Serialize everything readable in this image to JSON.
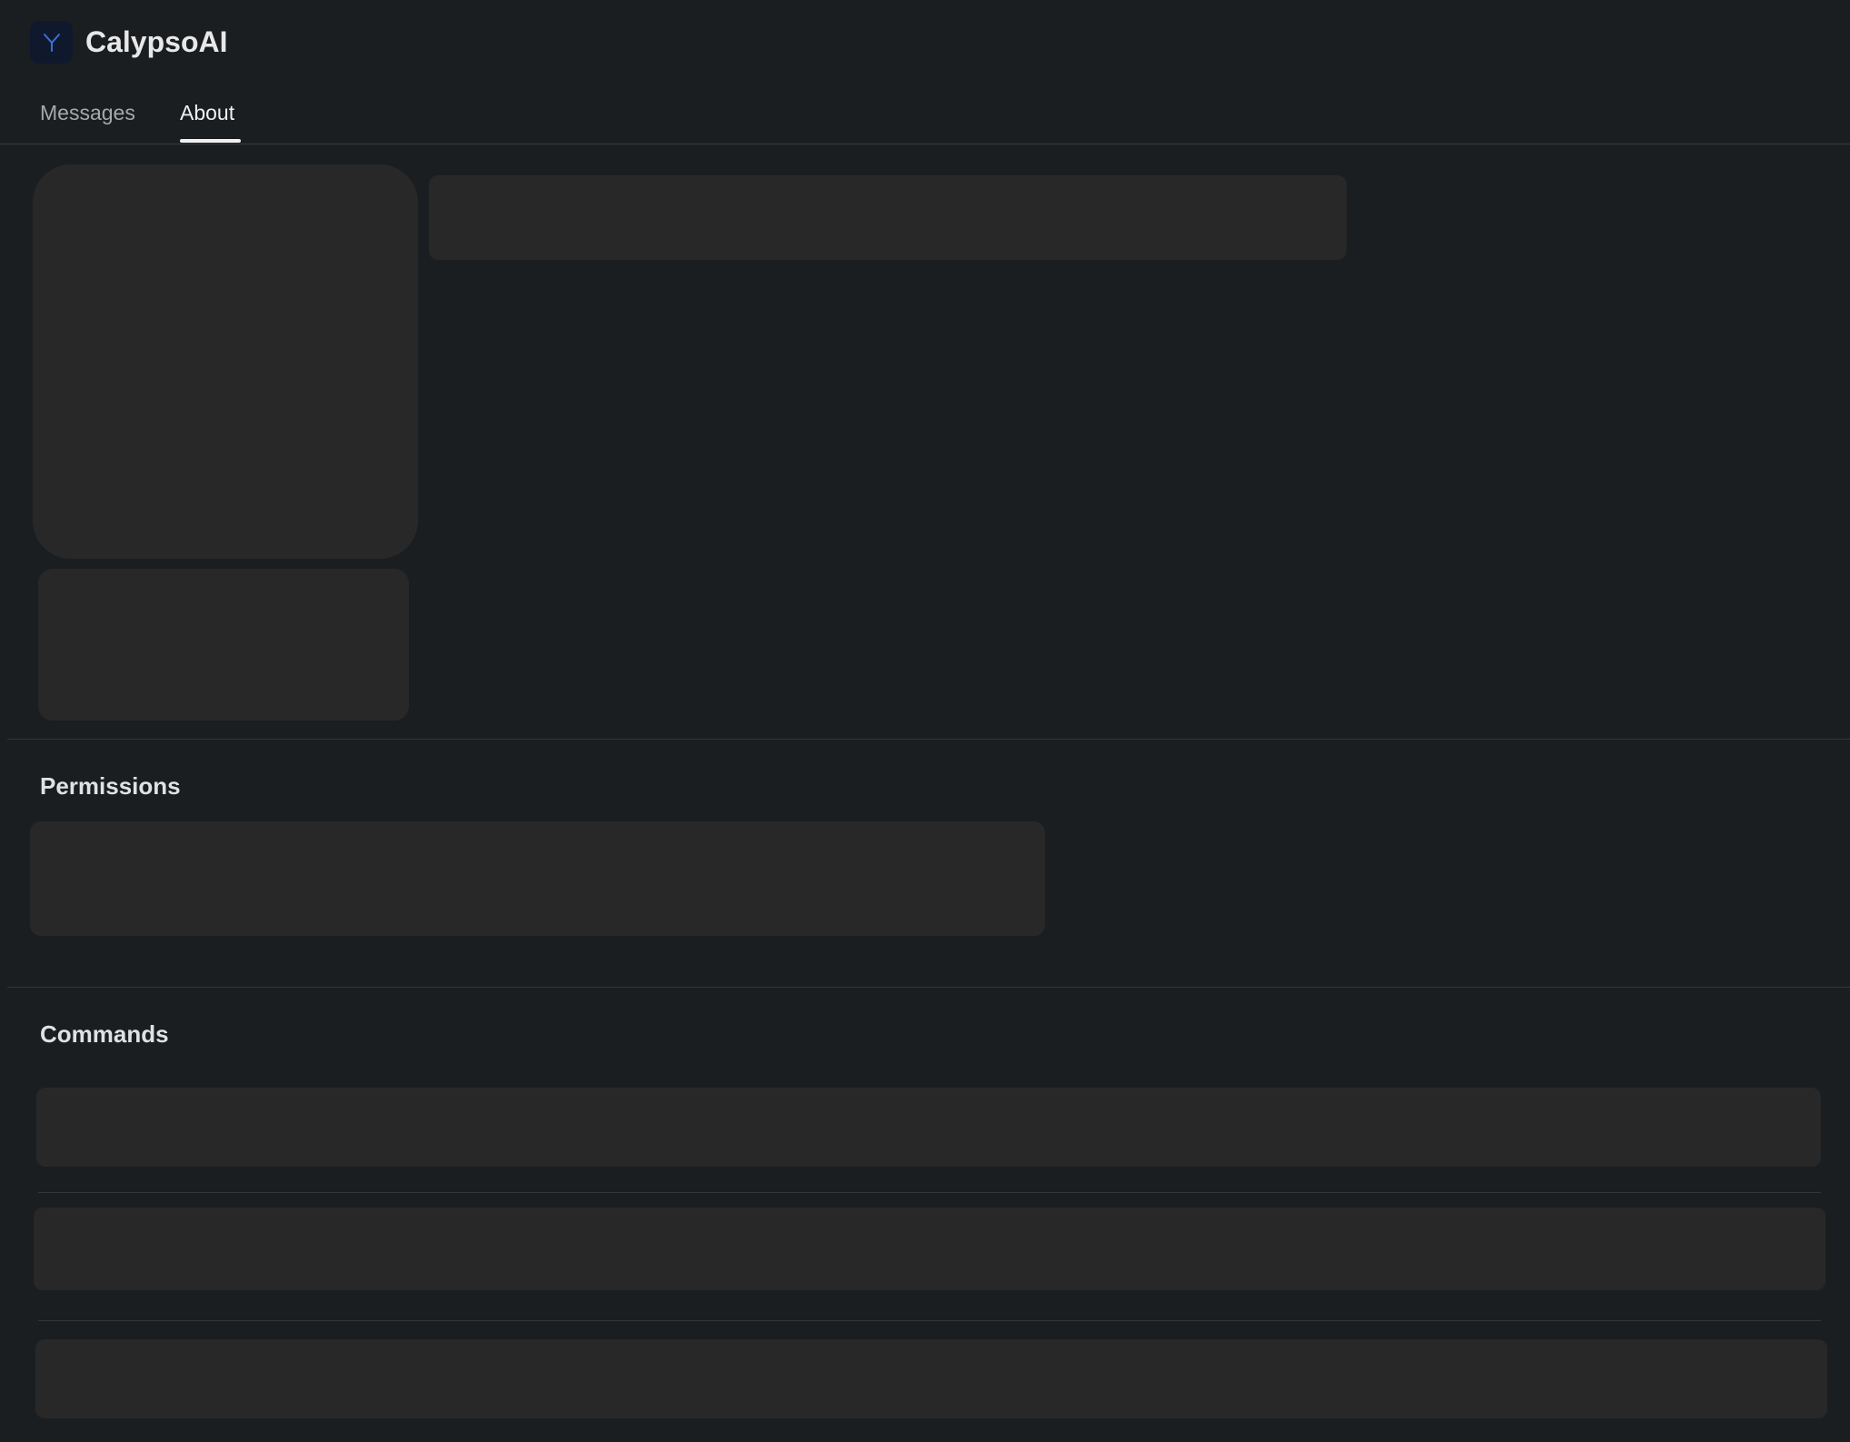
{
  "app": {
    "title": "CalypsoAI",
    "icon": "app-logo-icon",
    "icon_bg": "#10182e",
    "icon_fg": "#3b6fd6"
  },
  "tabs": [
    {
      "label": "Messages",
      "active": false
    },
    {
      "label": "About",
      "active": true
    }
  ],
  "sections": {
    "permissions": {
      "title": "Permissions"
    },
    "commands": {
      "title": "Commands"
    }
  },
  "colors": {
    "background": "#1b1e20",
    "skeleton": "#282828",
    "divider": "#34373a",
    "active_tab": "#f1f1f1",
    "inactive_tab": "#a6a8ab"
  }
}
